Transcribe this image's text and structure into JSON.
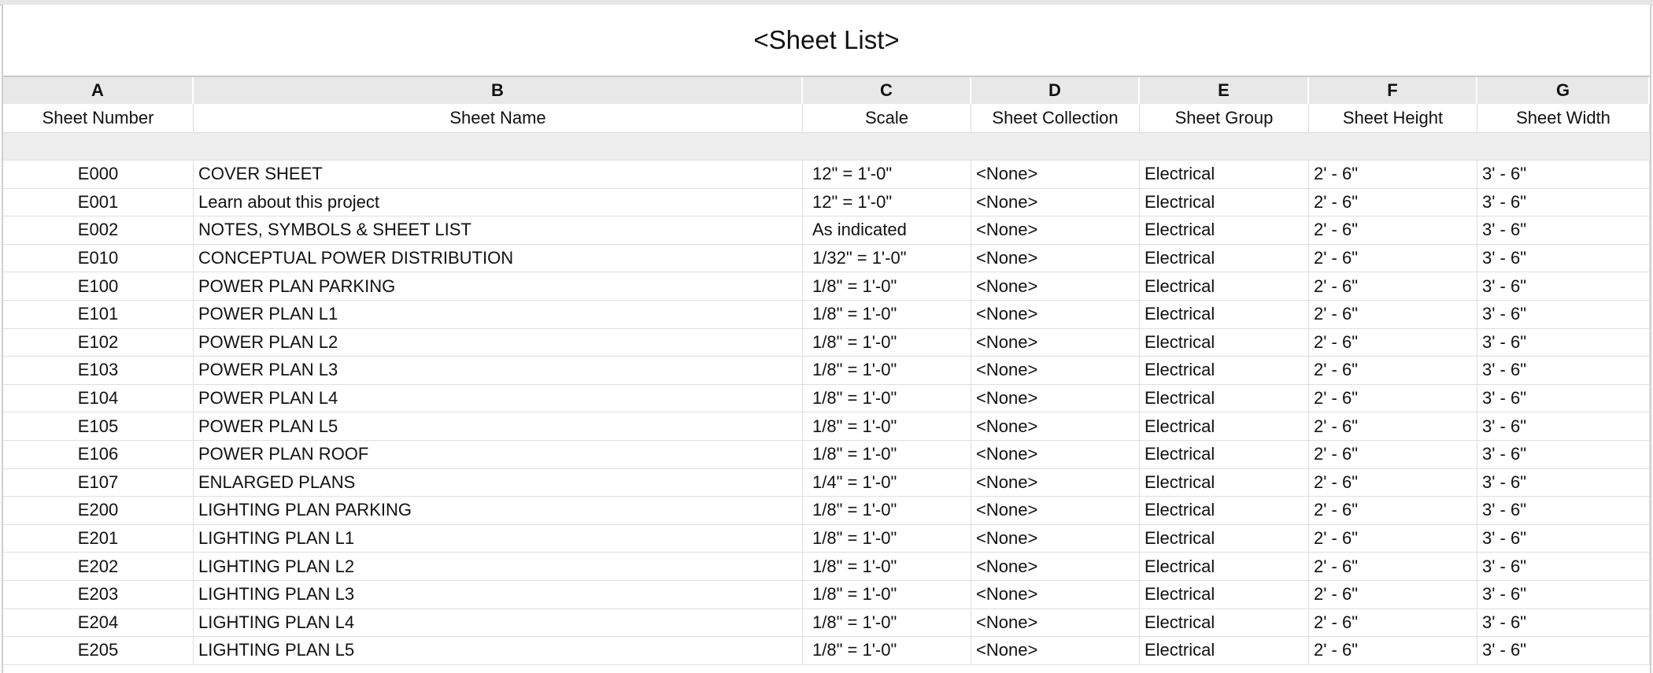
{
  "schedule": {
    "title": "<Sheet List>",
    "column_letters": [
      "A",
      "B",
      "C",
      "D",
      "E",
      "F",
      "G"
    ],
    "column_headers": [
      "Sheet Number",
      "Sheet Name",
      "Scale",
      "Sheet Collection",
      "Sheet Group",
      "Sheet Height",
      "Sheet Width"
    ],
    "rows": [
      [
        "E000",
        "COVER SHEET",
        "12\" = 1'-0\"",
        "<None>",
        "Electrical",
        "2' - 6\"",
        "3' - 6\""
      ],
      [
        "E001",
        "Learn about this project",
        "12\" = 1'-0\"",
        "<None>",
        "Electrical",
        "2' - 6\"",
        "3' - 6\""
      ],
      [
        "E002",
        "NOTES, SYMBOLS & SHEET LIST",
        "As indicated",
        "<None>",
        "Electrical",
        "2' - 6\"",
        "3' - 6\""
      ],
      [
        "E010",
        "CONCEPTUAL POWER DISTRIBUTION",
        "1/32\" = 1'-0\"",
        "<None>",
        "Electrical",
        "2' - 6\"",
        "3' - 6\""
      ],
      [
        "E100",
        "POWER PLAN PARKING",
        "1/8\" = 1'-0\"",
        "<None>",
        "Electrical",
        "2' - 6\"",
        "3' - 6\""
      ],
      [
        "E101",
        "POWER PLAN L1",
        "1/8\" = 1'-0\"",
        "<None>",
        "Electrical",
        "2' - 6\"",
        "3' - 6\""
      ],
      [
        "E102",
        "POWER PLAN L2",
        "1/8\" = 1'-0\"",
        "<None>",
        "Electrical",
        "2' - 6\"",
        "3' - 6\""
      ],
      [
        "E103",
        "POWER PLAN L3",
        "1/8\" = 1'-0\"",
        "<None>",
        "Electrical",
        "2' - 6\"",
        "3' - 6\""
      ],
      [
        "E104",
        "POWER PLAN L4",
        "1/8\" = 1'-0\"",
        "<None>",
        "Electrical",
        "2' - 6\"",
        "3' - 6\""
      ],
      [
        "E105",
        "POWER PLAN L5",
        "1/8\" = 1'-0\"",
        "<None>",
        "Electrical",
        "2' - 6\"",
        "3' - 6\""
      ],
      [
        "E106",
        "POWER PLAN ROOF",
        "1/8\" = 1'-0\"",
        "<None>",
        "Electrical",
        "2' - 6\"",
        "3' - 6\""
      ],
      [
        "E107",
        "ENLARGED PLANS",
        "1/4\" = 1'-0\"",
        "<None>",
        "Electrical",
        "2' - 6\"",
        "3' - 6\""
      ],
      [
        "E200",
        "LIGHTING PLAN PARKING",
        "1/8\" = 1'-0\"",
        "<None>",
        "Electrical",
        "2' - 6\"",
        "3' - 6\""
      ],
      [
        "E201",
        "LIGHTING PLAN L1",
        "1/8\" = 1'-0\"",
        "<None>",
        "Electrical",
        "2' - 6\"",
        "3' - 6\""
      ],
      [
        "E202",
        "LIGHTING PLAN L2",
        "1/8\" = 1'-0\"",
        "<None>",
        "Electrical",
        "2' - 6\"",
        "3' - 6\""
      ],
      [
        "E203",
        "LIGHTING PLAN L3",
        "1/8\" = 1'-0\"",
        "<None>",
        "Electrical",
        "2' - 6\"",
        "3' - 6\""
      ],
      [
        "E204",
        "LIGHTING PLAN L4",
        "1/8\" = 1'-0\"",
        "<None>",
        "Electrical",
        "2' - 6\"",
        "3' - 6\""
      ],
      [
        "E205",
        "LIGHTING PLAN L5",
        "1/8\" = 1'-0\"",
        "<None>",
        "Electrical",
        "2' - 6\"",
        "3' - 6\""
      ]
    ]
  },
  "colors": {
    "letter_row_bg": "#e8e8e8",
    "spacer_row_bg": "#eeeeee",
    "grid_line": "#e0e0e0"
  }
}
